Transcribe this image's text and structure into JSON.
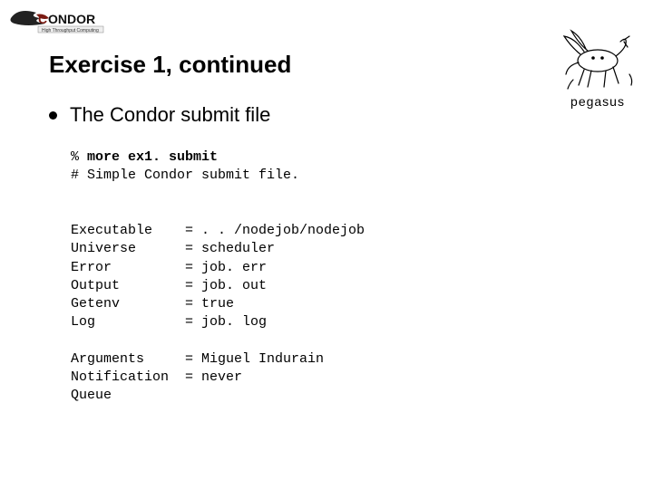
{
  "logos": {
    "pegasus_caption": "pegasus"
  },
  "title": "Exercise 1, continued",
  "bullet": "The Condor submit file",
  "code": {
    "cmd_prompt": "% ",
    "cmd": "more ex1. submit",
    "comment": "# Simple Condor submit file.",
    "block1": [
      {
        "k": "Executable",
        "v": ". . /nodejob/nodejob"
      },
      {
        "k": "Universe",
        "v": "scheduler"
      },
      {
        "k": "Error",
        "v": "job. err"
      },
      {
        "k": "Output",
        "v": "job. out"
      },
      {
        "k": "Getenv",
        "v": "true"
      },
      {
        "k": "Log",
        "v": "job. log"
      }
    ],
    "block2": [
      {
        "k": "Arguments",
        "v": "Miguel Indurain"
      },
      {
        "k": "Notification",
        "v": "never"
      },
      {
        "k": "Queue",
        "v": null
      }
    ]
  }
}
